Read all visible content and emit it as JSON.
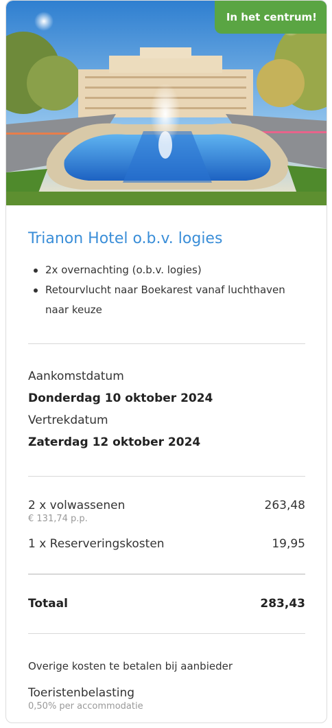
{
  "hero": {
    "badge": "In het centrum!",
    "image_alt": "Paleis van het Parlement met fontein"
  },
  "hotel": {
    "title": "Trianon Hotel o.b.v. logies",
    "features": [
      "2x overnachting (o.b.v. logies)",
      "Retourvlucht naar Boekarest vanaf luchthaven naar keuze"
    ]
  },
  "dates": {
    "arrival_label": "Aankomstdatum",
    "arrival_value": "Donderdag 10 oktober 2024",
    "departure_label": "Vertrekdatum",
    "departure_value": "Zaterdag 12 oktober 2024"
  },
  "pricing": {
    "lines": [
      {
        "label": "2 x volwassenen",
        "amount": "263,48",
        "sub": "€ 131,74 p.p."
      },
      {
        "label": "1 x Reserveringskosten",
        "amount": "19,95"
      }
    ],
    "total_label": "Totaal",
    "total_amount": "283,43"
  },
  "extra_costs": {
    "title": "Overige kosten te betalen bij aanbieder",
    "items": [
      {
        "label": "Toeristenbelasting",
        "sub": "0,50% per accommodatie"
      }
    ]
  },
  "colors": {
    "accent_blue": "#3a8ed8",
    "badge_green": "#5aa543"
  }
}
